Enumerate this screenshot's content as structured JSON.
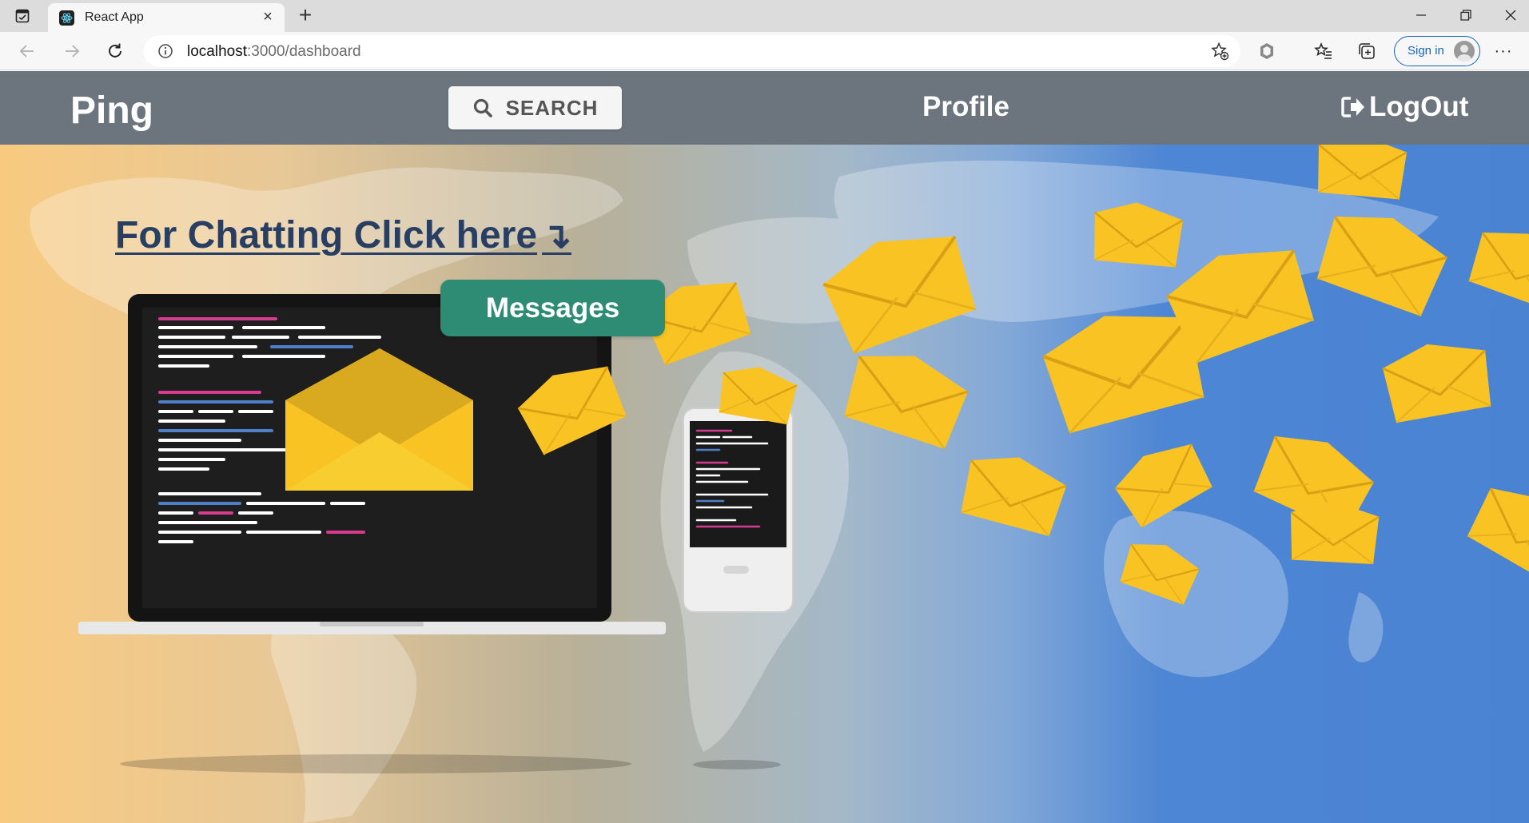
{
  "browser": {
    "tab_title": "React App",
    "url_host": "localhost",
    "url_path": ":3000/dashboard",
    "signin_label": "Sign in"
  },
  "app": {
    "brand": "Ping",
    "search_label": "SEARCH",
    "profile_label": "Profile",
    "logout_label": "LogOut",
    "cta_text": "For Chatting Click here",
    "cta_arrow": "↴",
    "messages_label": "Messages"
  },
  "colors": {
    "navbar": "#6c757d",
    "messages_button": "#2e8b74",
    "cta_text": "#283f63",
    "envelope": "#f9c324"
  }
}
